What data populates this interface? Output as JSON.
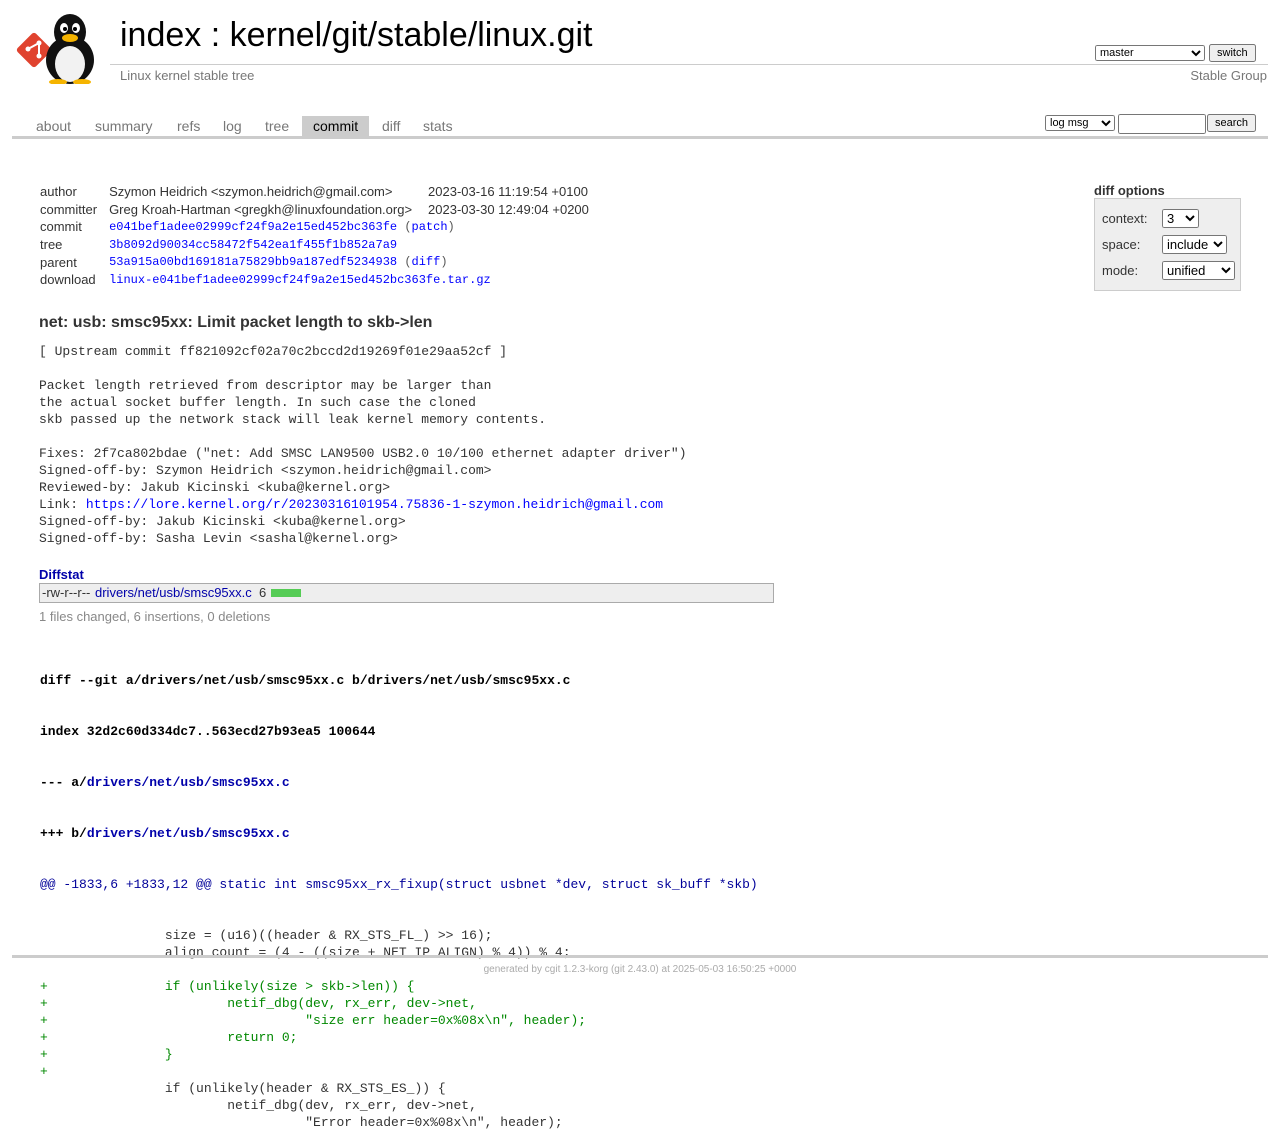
{
  "header": {
    "index_label": "index",
    "separator": " : ",
    "repo_path": "kernel/git/stable/linux.git",
    "repo_desc": "Linux kernel stable tree",
    "group_link": "Stable Group",
    "branch": {
      "selected": "master",
      "options": [
        "master"
      ]
    },
    "switch_label": "switch"
  },
  "tabs": [
    {
      "label": "about",
      "active": false
    },
    {
      "label": "summary",
      "active": false
    },
    {
      "label": "refs",
      "active": false
    },
    {
      "label": "log",
      "active": false
    },
    {
      "label": "tree",
      "active": false
    },
    {
      "label": "commit",
      "active": true
    },
    {
      "label": "diff",
      "active": false
    },
    {
      "label": "stats",
      "active": false
    }
  ],
  "search": {
    "type_selected": "log msg",
    "type_options": [
      "log msg"
    ],
    "query": "",
    "button": "search"
  },
  "commit_info": {
    "author_label": "author",
    "author": "Szymon Heidrich <szymon.heidrich@gmail.com>",
    "author_date": "2023-03-16 11:19:54 +0100",
    "committer_label": "committer",
    "committer": "Greg Kroah-Hartman <gregkh@linuxfoundation.org>",
    "committer_date": "2023-03-30 12:49:04 +0200",
    "commit_label": "commit",
    "commit": "e041bef1adee02999cf24f9a2e15ed452bc363fe",
    "commit_extra": "patch",
    "tree_label": "tree",
    "tree": "3b8092d90034cc58472f542ea1f455f1b852a7a9",
    "parent_label": "parent",
    "parent": "53a915a00bd169181a75829bb9a187edf5234938",
    "parent_extra": "diff",
    "download_label": "download",
    "download": "linux-e041bef1adee02999cf24f9a2e15ed452bc363fe.tar.gz"
  },
  "diff_options": {
    "title": "diff options",
    "context_label": "context:",
    "context_value": "3",
    "space_label": "space:",
    "space_value": "include",
    "mode_label": "mode:",
    "mode_value": "unified"
  },
  "message": {
    "subject": "net: usb: smsc95xx: Limit packet length to skb->len",
    "upstream": "[ Upstream commit ff821092cf02a70c2bccd2d19269f01e29aa52cf ]",
    "para1": "Packet length retrieved from descriptor may be larger than\nthe actual socket buffer length. In such case the cloned\nskb passed up the network stack will leak kernel memory contents.",
    "fixes": "Fixes: 2f7ca802bdae (\"net: Add SMSC LAN9500 USB2.0 10/100 ethernet adapter driver\")",
    "signed1": "Signed-off-by: Szymon Heidrich <szymon.heidrich@gmail.com>",
    "reviewed": "Reviewed-by: Jakub Kicinski <kuba@kernel.org>",
    "link_prefix": "Link: ",
    "link_url": "https://lore.kernel.org/r/20230316101954.75836-1-szymon.heidrich@gmail.com",
    "signed2": "Signed-off-by: Jakub Kicinski <kuba@kernel.org>",
    "signed3": "Signed-off-by: Sasha Levin <sashal@kernel.org>"
  },
  "diffstat": {
    "header": "Diffstat",
    "mode": "-rw-r--r--",
    "file": "drivers/net/usb/smsc95xx.c",
    "count": "6",
    "summary": "1 files changed, 6 insertions, 0 deletions"
  },
  "diff": {
    "git_line_prefix": "diff --git a/drivers/net/usb/smsc95xx.c b/drivers/net/usb/smsc95xx.c",
    "index_line": "index 32d2c60d334dc7..563ecd27b93ea5 100644",
    "minus_prefix": "--- a/",
    "plus_prefix": "+++ b/",
    "file_path": "drivers/net/usb/smsc95xx.c",
    "hunk": "@@ -1833,6 +1833,12 @@ static int smsc95xx_rx_fixup(struct usbnet *dev, struct sk_buff *skb)",
    "lines": [
      {
        "type": "ctx",
        "text": " \t\tsize = (u16)((header & RX_STS_FL_) >> 16);"
      },
      {
        "type": "ctx",
        "text": " \t\talign_count = (4 - ((size + NET_IP_ALIGN) % 4)) % 4;"
      },
      {
        "type": "ctx",
        "text": " "
      },
      {
        "type": "add",
        "text": "+\t\tif (unlikely(size > skb->len)) {"
      },
      {
        "type": "add",
        "text": "+\t\t\tnetif_dbg(dev, rx_err, dev->net,"
      },
      {
        "type": "add",
        "text": "+\t\t\t\t  \"size err header=0x%08x\\n\", header);"
      },
      {
        "type": "add",
        "text": "+\t\t\treturn 0;"
      },
      {
        "type": "add",
        "text": "+\t\t}"
      },
      {
        "type": "add",
        "text": "+"
      },
      {
        "type": "ctx",
        "text": " \t\tif (unlikely(header & RX_STS_ES_)) {"
      },
      {
        "type": "ctx",
        "text": " \t\t\tnetif_dbg(dev, rx_err, dev->net,"
      },
      {
        "type": "ctx",
        "text": " \t\t\t\t  \"Error header=0x%08x\\n\", header);"
      }
    ]
  },
  "footer": {
    "prefix": "generated by ",
    "cgit": "cgit 1.2.3-korg",
    "git": "(git 2.43.0)",
    "suffix": " at 2025-05-03 16:50:25 +0000"
  }
}
